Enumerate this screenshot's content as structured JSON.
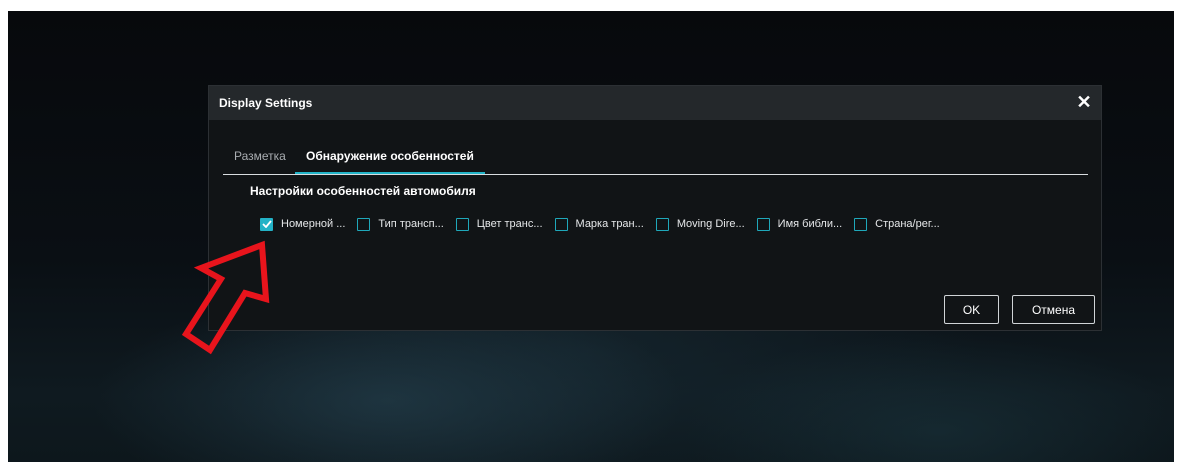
{
  "dialog": {
    "title": "Display Settings",
    "close_icon": "close-icon",
    "tabs": [
      {
        "label": "Разметка",
        "active": false
      },
      {
        "label": "Обнаружение особенностей",
        "active": true
      }
    ],
    "section_title": "Настройки особенностей автомобиля",
    "checkboxes": [
      {
        "label": "Номерной ...",
        "checked": true
      },
      {
        "label": "Тип трансп...",
        "checked": false
      },
      {
        "label": "Цвет транс...",
        "checked": false
      },
      {
        "label": "Марка тран...",
        "checked": false
      },
      {
        "label": "Moving Dire...",
        "checked": false
      },
      {
        "label": "Имя библи...",
        "checked": false
      },
      {
        "label": "Страна/рег...",
        "checked": false
      }
    ],
    "ok_label": "OK",
    "cancel_label": "Отмена"
  },
  "colors": {
    "accent": "#23b2c6",
    "annotation_arrow": "#e8141c",
    "dialog_bg": "#111416",
    "header_bg": "#24282b"
  }
}
